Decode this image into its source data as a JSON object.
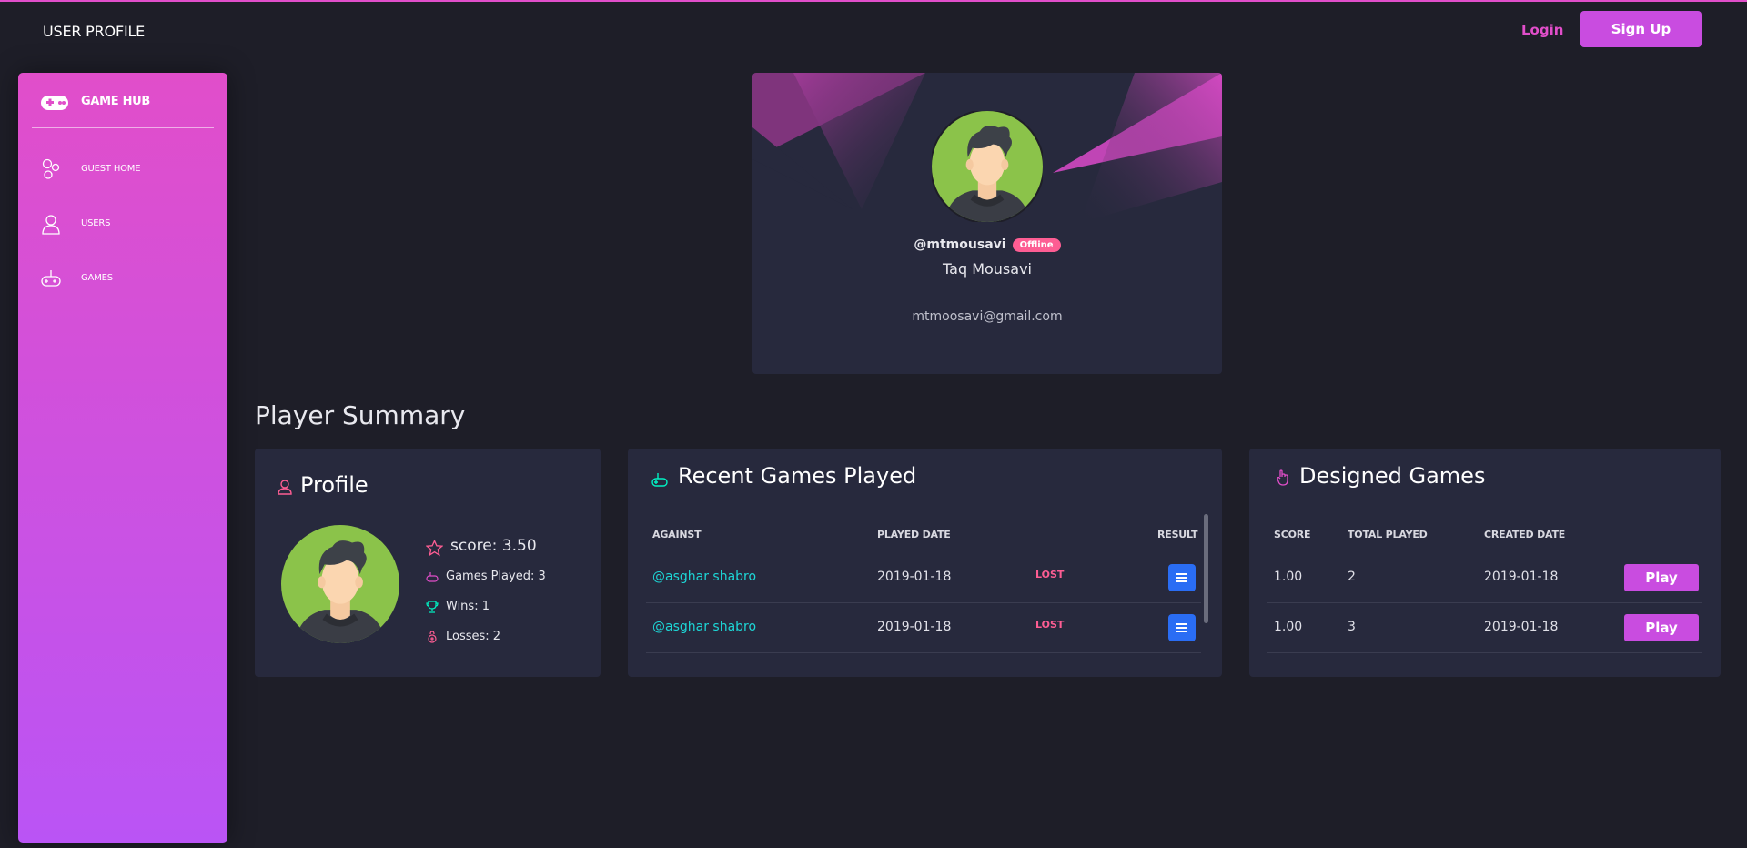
{
  "topbar": {
    "title": "USER PROFILE",
    "login_label": "Login",
    "signup_label": "Sign Up"
  },
  "sidebar": {
    "logo_icon": "gamepad-icon",
    "title": "GAME HUB",
    "items": [
      {
        "label": "GUEST HOME",
        "icon": "molecule-icon"
      },
      {
        "label": "USERS",
        "icon": "user-icon"
      },
      {
        "label": "GAMES",
        "icon": "controller-icon"
      }
    ]
  },
  "profile": {
    "handle": "@mtmousavi",
    "status": "Offline",
    "full_name": "Taq Mousavi",
    "email": "mtmoosavi@gmail.com"
  },
  "summary": {
    "heading": "Player Summary",
    "profile_card": {
      "title": "Profile",
      "score": "score: 3.50",
      "games_played": "Games Played: 3",
      "wins": "Wins: 1",
      "losses": "Losses: 2"
    },
    "recent": {
      "title": "Recent Games Played",
      "headers": {
        "against": "AGAINST",
        "played_date": "PLAYED DATE",
        "result": "RESULT"
      },
      "rows": [
        {
          "against": "@asghar shabro",
          "date": "2019-01-18",
          "result": "LOST"
        },
        {
          "against": "@asghar shabro",
          "date": "2019-01-18",
          "result": "LOST"
        }
      ]
    },
    "designed": {
      "title": "Designed Games",
      "headers": {
        "score": "SCORE",
        "total_played": "TOTAL PLAYED",
        "created_date": "CREATED DATE"
      },
      "rows": [
        {
          "score": "1.00",
          "total": "2",
          "date": "2019-01-18",
          "action": "Play"
        },
        {
          "score": "1.00",
          "total": "3",
          "date": "2019-01-18",
          "action": "Play"
        }
      ]
    }
  },
  "colors": {
    "accent": "#e14eca",
    "accent_purple": "#ba54f5",
    "card_bg": "#27293d",
    "page_bg": "#1e1e28",
    "link": "#1dd6d6",
    "lost": "#fd5d93",
    "button_blue": "#2a6df4"
  }
}
